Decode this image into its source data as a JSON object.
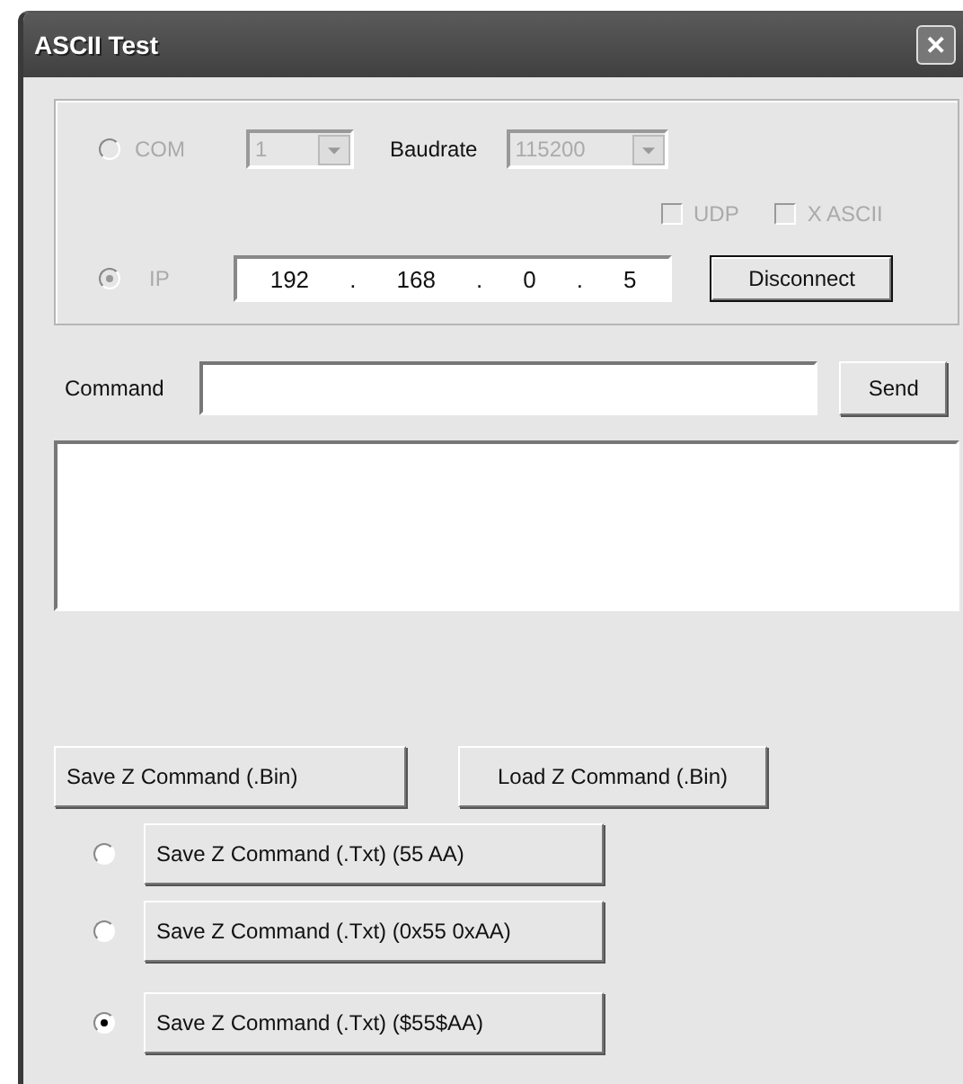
{
  "window": {
    "title": "ASCII Test",
    "close": "✕"
  },
  "connection": {
    "disabled": true,
    "com": {
      "label": "COM",
      "selected": false,
      "port": "1",
      "baud_label": "Baudrate",
      "baud": "115200"
    },
    "checkboxes": [
      {
        "label": "UDP",
        "checked": false
      },
      {
        "label": "X ASCII",
        "checked": false
      }
    ],
    "ip": {
      "label": "IP",
      "selected": true,
      "octets": [
        "192",
        "168",
        "0",
        "5"
      ],
      "dot": "."
    },
    "connect_button": "Disconnect"
  },
  "command": {
    "label": "Command",
    "send": "Send"
  },
  "bin_buttons": [
    "Save Z Command (.Bin)",
    "Load Z Command (.Bin)"
  ],
  "txt_options": [
    {
      "label": "Save Z Command (.Txt) (55 AA)",
      "selected": false
    },
    {
      "label": "Save Z Command (.Txt) (0x55 0xAA)",
      "selected": false
    },
    {
      "label": "Save Z Command (.Txt) ($55$AA)",
      "selected": true
    }
  ]
}
